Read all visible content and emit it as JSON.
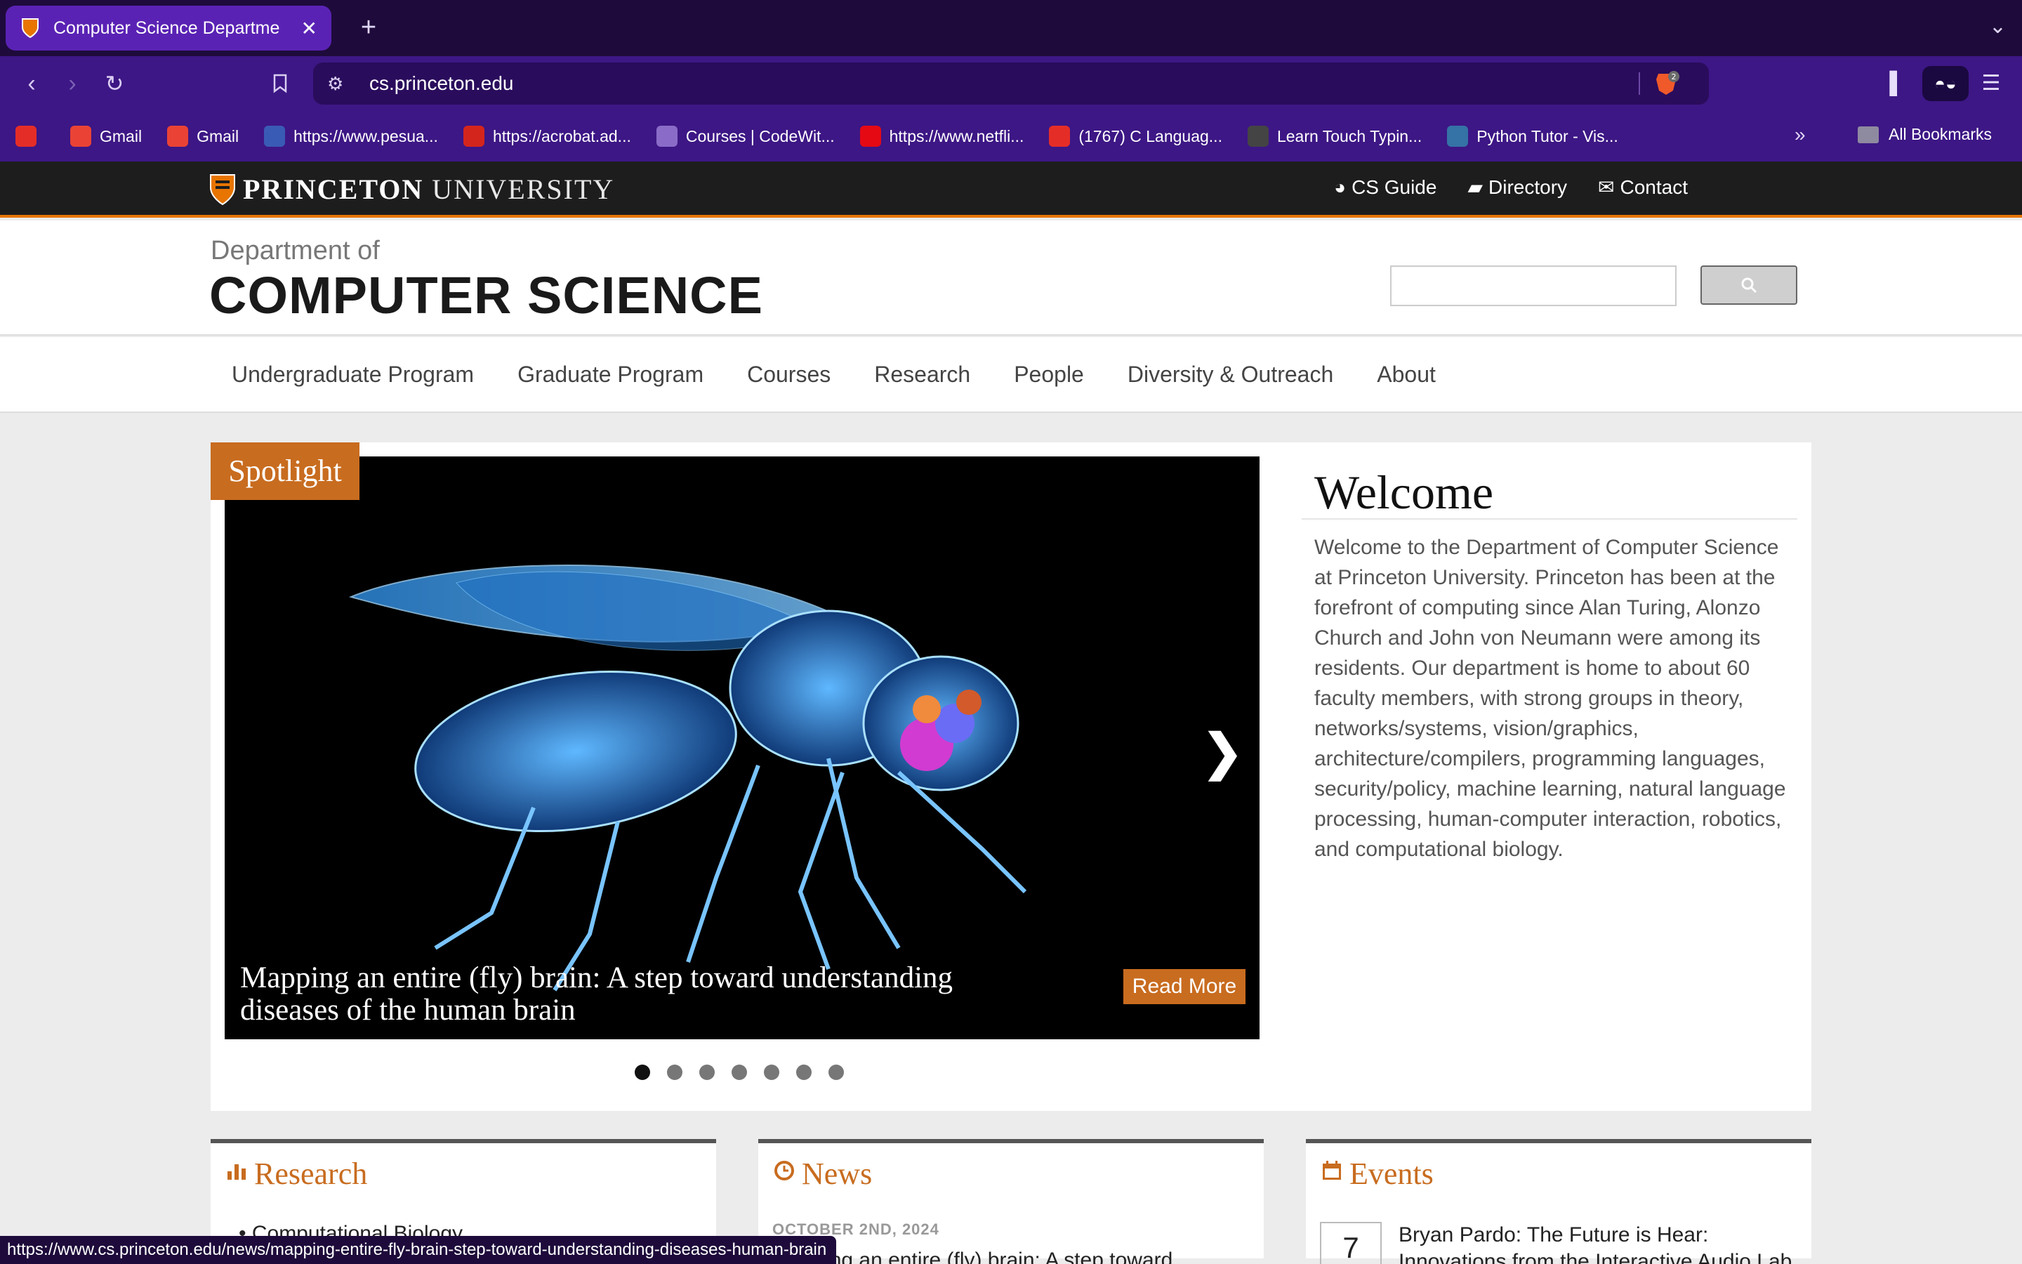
{
  "browser": {
    "tab_title": "Computer Science Departme",
    "tab_close": "✕",
    "new_tab": "+",
    "url": "cs.princeton.edu",
    "brave_badge": "2",
    "bookmarks": [
      {
        "label": "",
        "icon": "youtube-icon",
        "color": "#e52d27"
      },
      {
        "label": "Gmail",
        "icon": "gmail-icon",
        "color": "#ea4335"
      },
      {
        "label": "Gmail",
        "icon": "gmail-icon",
        "color": "#ea4335"
      },
      {
        "label": "https://www.pesua...",
        "icon": "pesu-icon",
        "color": "#3a5bb5"
      },
      {
        "label": "https://acrobat.ad...",
        "icon": "acrobat-icon",
        "color": "#d4251c"
      },
      {
        "label": "Courses | CodeWit...",
        "icon": "codewithharry-icon",
        "color": "#8a6cc8"
      },
      {
        "label": "https://www.netfli...",
        "icon": "netflix-icon",
        "color": "#e50914"
      },
      {
        "label": "(1767) C Languag...",
        "icon": "youtube-icon",
        "color": "#e52d27"
      },
      {
        "label": "Learn Touch Typin...",
        "icon": "typing-icon",
        "color": "#444444"
      },
      {
        "label": "Python Tutor - Vis...",
        "icon": "python-icon",
        "color": "#3572a5"
      }
    ],
    "bookmarks_more": "»",
    "all_bookmarks": "All Bookmarks",
    "status_url": "https://www.cs.princeton.edu/news/mapping-entire-fly-brain-step-toward-understanding-diseases-human-brain"
  },
  "site": {
    "university": "PRINCETON",
    "university_suffix": "UNIVERSITY",
    "top_links": [
      {
        "label": "CS Guide",
        "icon": "globe-icon"
      },
      {
        "label": "Directory",
        "icon": "folder-icon"
      },
      {
        "label": "Contact",
        "icon": "envelope-icon"
      }
    ],
    "dept_of": "Department of",
    "dept_name": "COMPUTER SCIENCE",
    "nav": [
      "Undergraduate Program",
      "Graduate Program",
      "Courses",
      "Research",
      "People",
      "Diversity & Outreach",
      "About"
    ]
  },
  "spotlight": {
    "tag": "Spotlight",
    "caption_line1": "Mapping an entire (fly) brain: A step toward understanding",
    "caption_line2": "diseases of the human brain",
    "read_more": "Read More",
    "slide_count": 7,
    "active_slide": 0
  },
  "welcome": {
    "title": "Welcome",
    "text": "Welcome to the Department of Computer Science at Princeton University. Princeton has been at the forefront of computing since Alan Turing, Alonzo Church and John von Neumann were among its residents. Our department is home to about 60 faculty members, with strong groups in theory, networks/systems, vision/graphics, architecture/compilers, programming languages, security/policy, machine learning, natural language processing, human-computer interaction, robotics, and computational biology."
  },
  "sections": {
    "research_title": "Research",
    "research_item": "Computational Biology",
    "news_title": "News",
    "news_date": "OCTOBER 2ND, 2024",
    "news_item": "Mapping an entire (fly) brain: A step toward",
    "events_title": "Events",
    "event_day": "7",
    "event_title": "Bryan Pardo: The Future is Hear: Innovations from the Interactive Audio Lab"
  },
  "colors": {
    "accent": "#c86c1f",
    "princeton_orange": "#e77500",
    "browser_bg": "#3d1785"
  }
}
